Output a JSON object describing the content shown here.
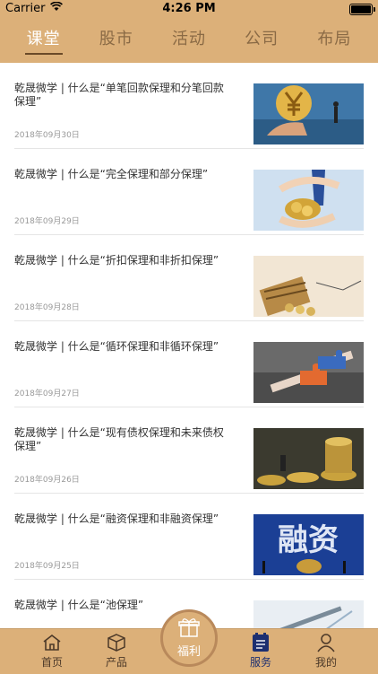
{
  "status_bar": {
    "carrier": "Carrier",
    "time": "4:26 PM"
  },
  "top_tabs": [
    {
      "label": "课堂",
      "active": true
    },
    {
      "label": "股市",
      "active": false
    },
    {
      "label": "活动",
      "active": false
    },
    {
      "label": "公司",
      "active": false
    },
    {
      "label": "布局",
      "active": false
    }
  ],
  "articles": [
    {
      "title": "乾晟微学 | 什么是“单笔回款保理和分笔回款保理”",
      "date": "2018年09月30日",
      "thumb": "yen-coin-image"
    },
    {
      "title": "乾晟微学 | 什么是“完全保理和部分保理”",
      "date": "2018年09月29日",
      "thumb": "hands-coins-image"
    },
    {
      "title": "乾晟微学 | 什么是“折扣保理和非折扣保理”",
      "date": "2018年09月28日",
      "thumb": "abacus-image"
    },
    {
      "title": "乾晟微学 | 什么是“循环保理和非循环保理”",
      "date": "2018年09月27日",
      "thumb": "puzzle-image"
    },
    {
      "title": "乾晟微学 | 什么是“现有债权保理和未来债权保理”",
      "date": "2018年09月26日",
      "thumb": "coins-stack-image"
    },
    {
      "title": "乾晟微学 | 什么是“融资保理和非融资保理”",
      "date": "2018年09月25日",
      "thumb": "financing-image",
      "thumb_text": "融资"
    },
    {
      "title": "乾晟微学 | 什么是“池保理”",
      "date": "",
      "thumb": "pen-chart-image"
    }
  ],
  "tabbar": {
    "home": "首页",
    "products": "产品",
    "gift": "福利",
    "service": "服务",
    "mine": "我的",
    "active": "service"
  },
  "colors": {
    "gold": "#dcb079",
    "active_blue": "#1d2f70",
    "brown": "#4b3828"
  }
}
